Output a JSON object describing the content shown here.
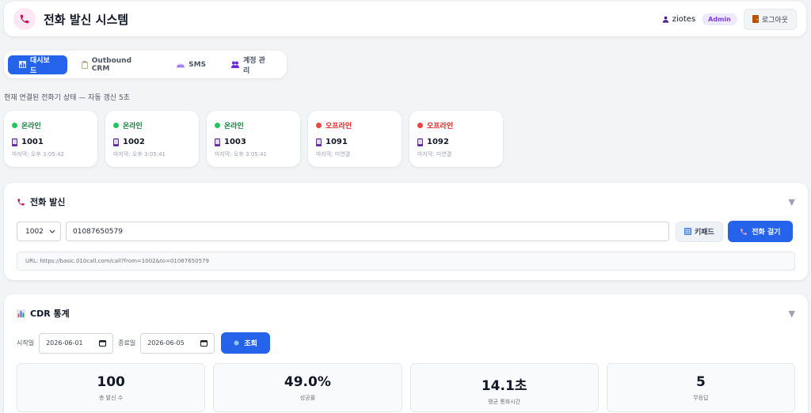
{
  "header": {
    "title": "전화 발신 시스템",
    "user": "ziotes",
    "role": "Admin",
    "logout": "로그아웃"
  },
  "tabs": [
    {
      "label": "대시보드",
      "active": true
    },
    {
      "label": "Outbound CRM",
      "active": false
    },
    {
      "label": "SMS",
      "active": false
    },
    {
      "label": "계정 관리",
      "active": false
    }
  ],
  "status_caption": "현재 연결된 전화기 상태 — 자동 갱신 5초",
  "phones": [
    {
      "status": "온라인",
      "ext": "1001",
      "last": "마지막: 오후 3:05:42",
      "online": true
    },
    {
      "status": "온라인",
      "ext": "1002",
      "last": "마지막: 오후 3:05:41",
      "online": true
    },
    {
      "status": "온라인",
      "ext": "1003",
      "last": "마지막: 오후 3:05:41",
      "online": true
    },
    {
      "status": "오프라인",
      "ext": "1091",
      "last": "마지막: 미연결",
      "online": false
    },
    {
      "status": "오프라인",
      "ext": "1092",
      "last": "마지막: 미연결",
      "online": false
    }
  ],
  "dial": {
    "title": "전화 발신",
    "selected_ext": "1002",
    "number": "01087650579",
    "keypad_label": "키패드",
    "call_label": "전화 걸기",
    "url": "URL: https://basic.010call.com/call?from=1002&to=01087650579"
  },
  "cdr": {
    "title": "CDR 통계",
    "start_label": "시작일",
    "start_date": "2026-06-01",
    "end_label": "종료일",
    "end_date": "2026-06-05",
    "query_label": "조회",
    "stats": [
      {
        "value": "100",
        "label": "총 발신 수"
      },
      {
        "value": "49.0%",
        "label": "성공률"
      },
      {
        "value": "14.1초",
        "label": "평균 통화시간"
      },
      {
        "value": "5",
        "label": "무응답"
      }
    ]
  },
  "colors": {
    "accent": "#2563eb",
    "online": "#22c55e",
    "offline": "#ef4444",
    "online_text": "#15803d",
    "offline_text": "#dc2626"
  }
}
